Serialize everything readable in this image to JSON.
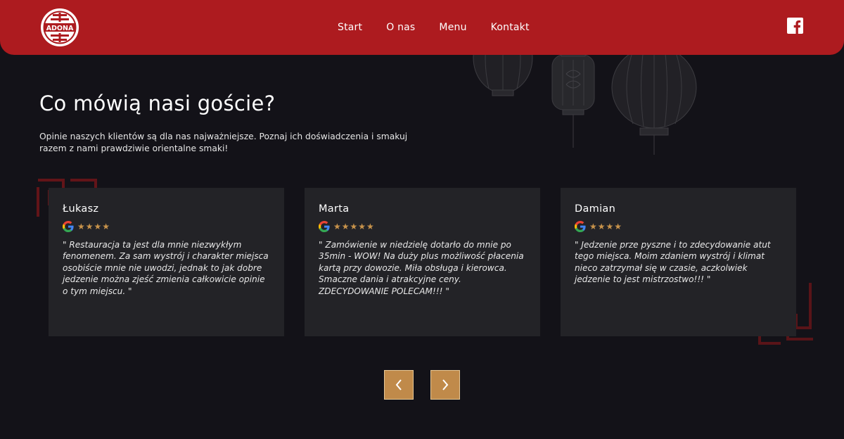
{
  "nav": {
    "logo_text": "ADONA",
    "items": [
      {
        "label": "Start"
      },
      {
        "label": "O nas"
      },
      {
        "label": "Menu"
      },
      {
        "label": "Kontakt"
      }
    ],
    "social_icon": "facebook-icon"
  },
  "section": {
    "title": "Co mówią nasi goście?",
    "intro": "Opinie naszych klientów są dla nas najważniejsze. Poznaj ich doświadczenia i smakuj razem z nami prawdziwie orientalne smaki!"
  },
  "reviews": [
    {
      "name": "Łukasz",
      "stars": "★★★★",
      "rating": 4,
      "text": "\" Restauracja ta jest dla mnie niezwykłym fenomenem. Za sam wystrój i charakter miejsca osobiście mnie nie uwodzi, jednak to jak dobre jedzenie można zjeść zmienia całkowicie opinie o tym miejscu. \""
    },
    {
      "name": "Marta",
      "stars": "★★★★★",
      "rating": 5,
      "text": "\" Zamówienie w niedzielę dotarło do mnie po 35min - WOW! Na duży plus możliwość płacenia kartą przy dowozie. Miła obsługa i kierowca. Smaczne dania i atrakcyjne ceny. ZDECYDOWANIE POLECAM!!! \""
    },
    {
      "name": "Damian",
      "stars": "★★★★",
      "rating": 4,
      "text": "\" Jedzenie prze pyszne i to zdecydowanie atut tego miejsca. Moim zdaniem wystrój i klimat nieco zatrzymał się w czasie, aczkolwiek jedzenie to jest mistrzostwo!!! \""
    }
  ],
  "slider": {
    "prev_icon": "chevron-left-icon",
    "next_icon": "chevron-right-icon"
  },
  "colors": {
    "brand_red": "#ad1b1f",
    "background": "#131218",
    "card": "#232327",
    "accent_gold": "#c08a4a",
    "star": "#c8934b"
  }
}
